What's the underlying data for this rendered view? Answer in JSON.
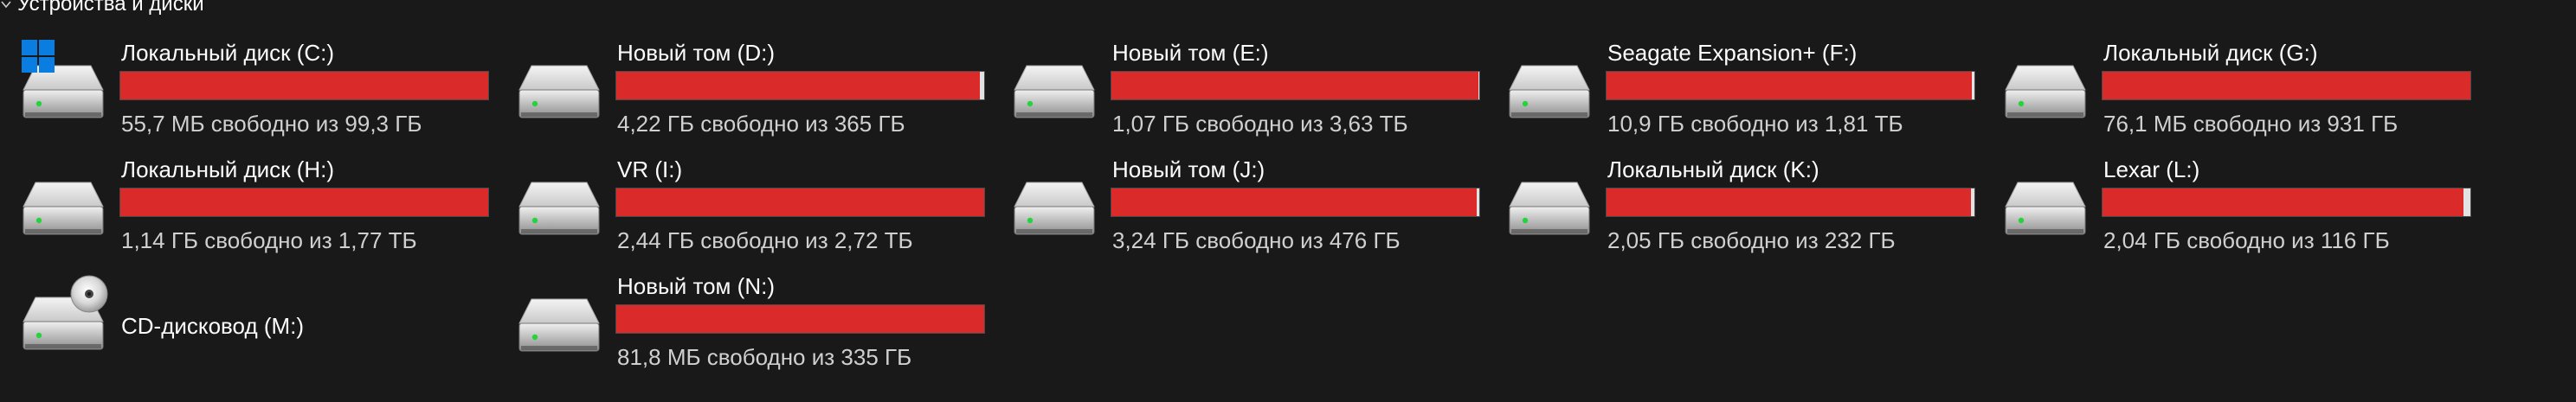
{
  "section": {
    "title": "Устройства и диски",
    "icon": "chevron-down-icon"
  },
  "colors": {
    "usage_bar_full": "#da2a2a",
    "usage_bar_empty": "#e2e2e2",
    "background": "#191919",
    "windows_logo": "#0a7ee0"
  },
  "drives": [
    {
      "name": "Локальный диск (C:)",
      "free": "55,7 МБ свободно из 99,3 ГБ",
      "used_fraction": 0.999,
      "icon": "hard-drive-icon",
      "system": true
    },
    {
      "name": "Новый том (D:)",
      "free": "4,22 ГБ свободно из 365 ГБ",
      "used_fraction": 0.988,
      "icon": "hard-drive-icon"
    },
    {
      "name": "Новый том (E:)",
      "free": "1,07 ГБ свободно из 3,63 ТБ",
      "used_fraction": 0.997,
      "icon": "hard-drive-icon"
    },
    {
      "name": "Seagate Expansion+ (F:)",
      "free": "10,9 ГБ свободно из 1,81 ТБ",
      "used_fraction": 0.994,
      "icon": "hard-drive-icon"
    },
    {
      "name": "Локальный диск (G:)",
      "free": "76,1 МБ свободно из 931 ГБ",
      "used_fraction": 0.999,
      "icon": "hard-drive-icon"
    },
    {
      "name": "Локальный диск (H:)",
      "free": "1,14 ГБ свободно из 1,77 ТБ",
      "used_fraction": 0.999,
      "icon": "hard-drive-icon"
    },
    {
      "name": "VR (I:)",
      "free": "2,44 ГБ свободно из 2,72 ТБ",
      "used_fraction": 0.999,
      "icon": "hard-drive-icon"
    },
    {
      "name": "Новый том (J:)",
      "free": "3,24 ГБ свободно из 476 ГБ",
      "used_fraction": 0.993,
      "icon": "hard-drive-icon"
    },
    {
      "name": "Локальный диск (K:)",
      "free": "2,05 ГБ свободно из 232 ГБ",
      "used_fraction": 0.991,
      "icon": "hard-drive-icon"
    },
    {
      "name": "Lexar (L:)",
      "free": "2,04 ГБ свободно из 116 ГБ",
      "used_fraction": 0.982,
      "icon": "hard-drive-icon"
    },
    {
      "name": "CD-дисковод (M:)",
      "free": "",
      "used_fraction": null,
      "icon": "cd-drive-icon"
    },
    {
      "name": "Новый том (N:)",
      "free": "81,8 МБ свободно из 335 ГБ",
      "used_fraction": 0.999,
      "icon": "hard-drive-icon"
    }
  ]
}
